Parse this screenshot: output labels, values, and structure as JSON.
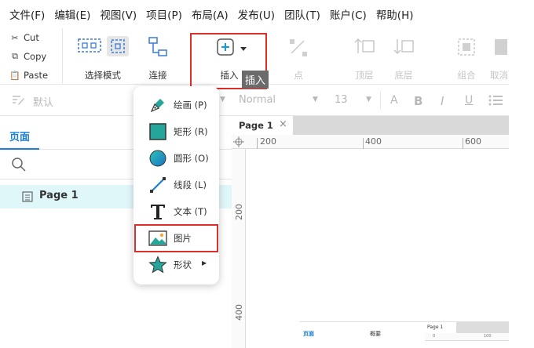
{
  "menu": [
    "文件(F)",
    "编辑(E)",
    "视图(V)",
    "项目(P)",
    "布局(A)",
    "发布(U)",
    "团队(T)",
    "账户(C)",
    "帮助(H)"
  ],
  "clipboard": {
    "cut": "Cut",
    "copy": "Copy",
    "paste": "Paste"
  },
  "toolbar": {
    "select_mode": "选择模式",
    "connect": "连接",
    "insert": "插入",
    "point": "点",
    "top_layer": "顶层",
    "bottom_layer": "底层",
    "group": "组合",
    "ungroup": "取消"
  },
  "tooltip": "插入",
  "stylebar": {
    "style": "默认",
    "font": "Normal",
    "size": "13"
  },
  "pages_panel": {
    "tab": "页面",
    "pages": [
      "Page 1"
    ]
  },
  "canvas": {
    "tab": "Page 1",
    "close": "×",
    "ruler_h": [
      "200",
      "400",
      "600"
    ],
    "ruler_v": [
      "200",
      "400"
    ]
  },
  "insert_menu": [
    {
      "icon": "pen-icon",
      "label": "绘画 (P)"
    },
    {
      "icon": "rectangle-icon",
      "label": "矩形 (R)"
    },
    {
      "icon": "circle-icon",
      "label": "圆形 (O)"
    },
    {
      "icon": "line-icon",
      "label": "线段 (L)"
    },
    {
      "icon": "text-icon",
      "label": "文本 (T)"
    },
    {
      "icon": "image-icon",
      "label": "图片"
    },
    {
      "icon": "star-icon",
      "label": "形状"
    }
  ],
  "thumbnail": {
    "pages_tab": "页面",
    "overview_tab": "概要",
    "page_tab": "Page 1",
    "ruler": [
      "0",
      "100"
    ]
  },
  "colors": {
    "accent": "#1a7fd1",
    "highlight": "#d9302a",
    "selected_row": "#e0f7fa",
    "shape_teal": "#26a69a"
  }
}
